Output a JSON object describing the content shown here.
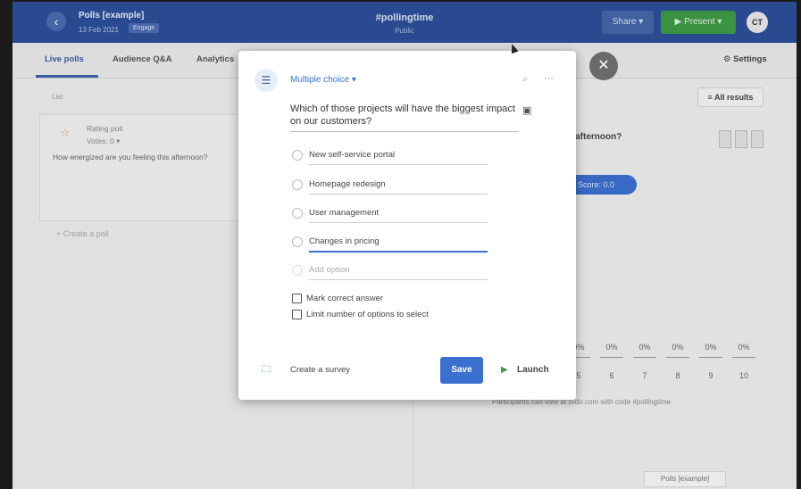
{
  "header": {
    "title": "Polls [example]",
    "date": "13 Feb 2021",
    "badge": "Engage",
    "event_code": "#pollingtime",
    "event_sub": "Public",
    "share_label": "Share ▾",
    "present_label": "▶ Present ▾",
    "avatar_initials": "CT"
  },
  "tabs": [
    "Live polls",
    "Audience Q&A",
    "Analytics"
  ],
  "settings_label": "⚙ Settings",
  "left_panel": {
    "list_label": "List",
    "poll_type": "Rating poll",
    "poll_votes": "Votes: 0 ▾",
    "poll_question": "How energized are you feeling this afternoon?",
    "create_poll": "+   Create a poll"
  },
  "right_panel": {
    "all_results": "≡ All results",
    "question_fragment": "is afternoon?",
    "score_label": "Score: 0.0",
    "percents": [
      "0%",
      "0%",
      "0%",
      "0%",
      "0%",
      "0%"
    ],
    "scale_numbers": [
      "5",
      "6",
      "7",
      "8",
      "9",
      "10"
    ],
    "join_info": "Participants can vote at slido.com with code #pollingtime",
    "footer_badge": "Polls [example]"
  },
  "modal": {
    "type_label": "Multiple choice ▾",
    "question": "Which of those projects will have the biggest impact on our customers?",
    "options": [
      "New self-service portal",
      "Homepage redesign",
      "User management",
      "Changes in pricing"
    ],
    "add_option_placeholder": "Add option",
    "mark_correct": "Mark correct answer",
    "limit_options": "Limit number of options to select",
    "create_survey": "Create a survey",
    "save_label": "Save",
    "launch_label": "Launch"
  }
}
